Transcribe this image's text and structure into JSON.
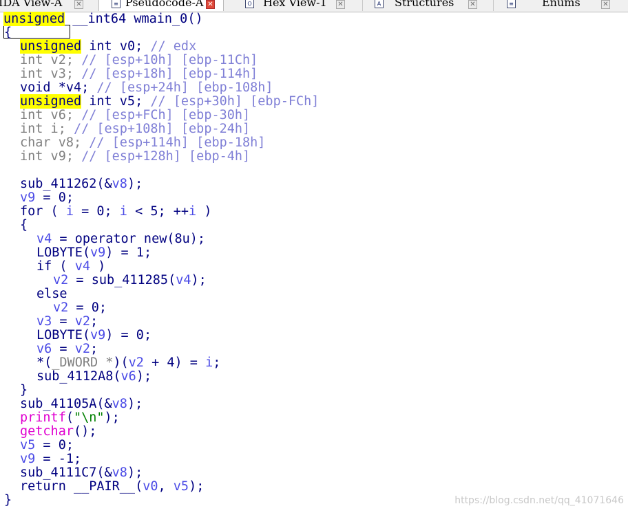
{
  "tabs": [
    {
      "label": "IDA View-A",
      "active": false
    },
    {
      "label": "Pseudocode-A",
      "active": true
    },
    {
      "label": "Hex View-1",
      "active": false
    },
    {
      "label": "Structures",
      "active": false
    },
    {
      "label": "Enums",
      "active": false
    }
  ],
  "code": {
    "l1": {
      "kw": "unsigned",
      "rest": " __int64 wmain_0()"
    },
    "l2": "{",
    "l3": {
      "kw": "unsigned",
      "type": " int ",
      "var": "v0",
      "semi": "; ",
      "comment": "// edx"
    },
    "l4": {
      "decl": "int v2; ",
      "comment": "// [esp+10h] [ebp-11Ch]"
    },
    "l5": {
      "decl": "int v3; ",
      "comment": "// [esp+18h] [ebp-114h]"
    },
    "l6": {
      "decl": "void *v4; ",
      "comment": "// [esp+24h] [ebp-108h]"
    },
    "l7": {
      "kw": "unsigned",
      "type": " int v5; ",
      "comment": "// [esp+30h] [ebp-FCh]"
    },
    "l8": {
      "decl": "int v6; ",
      "comment": "// [esp+FCh] [ebp-30h]"
    },
    "l9": {
      "decl": "int i; ",
      "comment": "// [esp+108h] [ebp-24h]"
    },
    "l10": {
      "decl": "char v8; ",
      "comment": "// [esp+114h] [ebp-18h]"
    },
    "l11": {
      "decl": "int v9; ",
      "comment": "// [esp+128h] [ebp-4h]"
    },
    "l13": {
      "a": "sub_411262(&",
      "v": "v8",
      "b": ");"
    },
    "l14": {
      "v": "v9",
      "b": " = 0;"
    },
    "l15": {
      "a": "for ( ",
      "v1": "i",
      "b": " = 0; ",
      "v2": "i",
      "c": " < 5; ++",
      "v3": "i",
      "d": " )"
    },
    "l16": "{",
    "l17": {
      "v": "v4",
      "b": " = operator new(8u);"
    },
    "l18": {
      "a": "LOBYTE(",
      "v": "v9",
      "b": ") = 1;"
    },
    "l19": {
      "a": "if ( ",
      "v": "v4",
      "b": " )"
    },
    "l20": {
      "v": "v2",
      "b": " = sub_411285(",
      "v2": "v4",
      "c": ");"
    },
    "l21": "else",
    "l22": {
      "v": "v2",
      "b": " = 0;"
    },
    "l23": {
      "v": "v3",
      "b": " = ",
      "v2": "v2",
      "c": ";"
    },
    "l24": {
      "a": "LOBYTE(",
      "v": "v9",
      "b": ") = 0;"
    },
    "l25": {
      "v": "v6",
      "b": " = ",
      "v2": "v2",
      "c": ";"
    },
    "l26": {
      "a": "*(",
      "t": "_DWORD *",
      "b": ")(",
      "v": "v2",
      "c": " + 4) = ",
      "v2": "i",
      "d": ";"
    },
    "l27": {
      "a": "sub_4112A8(",
      "v": "v6",
      "b": ");"
    },
    "l28": "}",
    "l29": {
      "a": "sub_41105A(&",
      "v": "v8",
      "b": ");"
    },
    "l30": {
      "f": "printf",
      "a": "(",
      "s": "\"\\n\"",
      "b": ");"
    },
    "l31": {
      "f": "getchar",
      "b": "();"
    },
    "l32": {
      "v": "v5",
      "b": " = 0;"
    },
    "l33": {
      "v": "v9",
      "b": " = -1;"
    },
    "l34": {
      "a": "sub_4111C7(&",
      "v": "v8",
      "b": ");"
    },
    "l35": {
      "a": "return __PAIR__(",
      "v": "v0",
      "b": ", ",
      "v2": "v5",
      "c": ");"
    },
    "l36": "}"
  },
  "watermark": "https://blog.csdn.net/qq_41071646",
  "colors": {
    "highlight": "#ffff00",
    "keyword": "#000080",
    "variable": "#4a4ae6",
    "comment": "#7f7fd6",
    "library_fn": "#e000d0",
    "string": "#008000"
  }
}
